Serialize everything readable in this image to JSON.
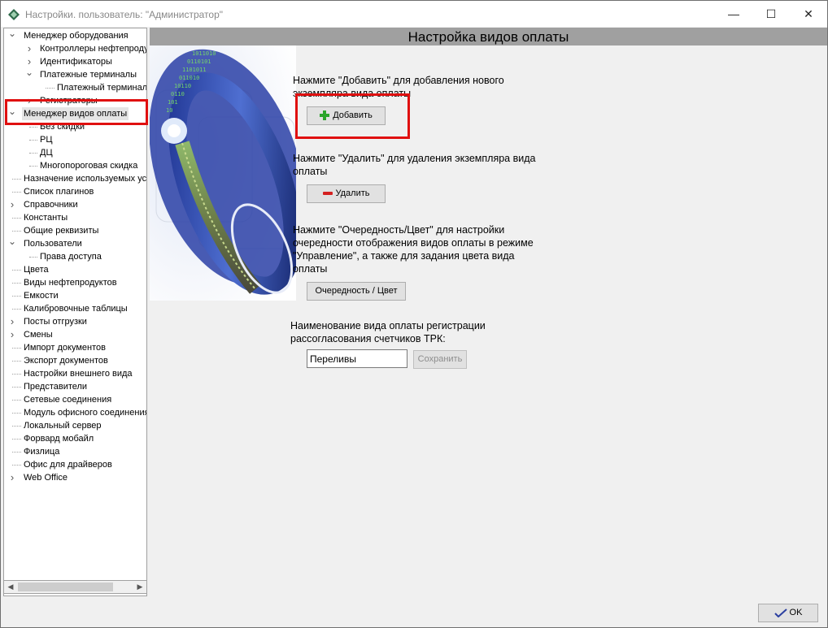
{
  "window": {
    "title": "Настройки. пользователь: \"Администратор\"",
    "minimize_glyph": "—",
    "maximize_glyph": "☐",
    "close_glyph": "✕"
  },
  "tree": {
    "items": [
      {
        "label": "Менеджер оборудования",
        "level": 0,
        "expander": "down"
      },
      {
        "label": "Контроллеры нефтепродуктов",
        "level": 1,
        "expander": "right"
      },
      {
        "label": "Идентификаторы",
        "level": 1,
        "expander": "right"
      },
      {
        "label": "Платежные терминалы",
        "level": 1,
        "expander": "down"
      },
      {
        "label": "Платежный терминал",
        "level": 2,
        "expander": "none"
      },
      {
        "label": "Регистраторы",
        "level": 1,
        "expander": "right"
      },
      {
        "label": "Менеджер видов оплаты",
        "level": 0,
        "expander": "down",
        "selected": true
      },
      {
        "label": "Без скидки",
        "level": 1,
        "expander": "none"
      },
      {
        "label": "РЦ",
        "level": 1,
        "expander": "none"
      },
      {
        "label": "ДЦ",
        "level": 1,
        "expander": "none"
      },
      {
        "label": "Многопороговая скидка",
        "level": 1,
        "expander": "none"
      },
      {
        "label": "Назначение используемых устройств",
        "level": 0,
        "expander": "none"
      },
      {
        "label": "Список плагинов",
        "level": 0,
        "expander": "none"
      },
      {
        "label": "Справочники",
        "level": 0,
        "expander": "right"
      },
      {
        "label": "Константы",
        "level": 0,
        "expander": "none"
      },
      {
        "label": "Общие реквизиты",
        "level": 0,
        "expander": "none"
      },
      {
        "label": "Пользователи",
        "level": 0,
        "expander": "down"
      },
      {
        "label": "Права доступа",
        "level": 1,
        "expander": "none"
      },
      {
        "label": "Цвета",
        "level": 0,
        "expander": "none"
      },
      {
        "label": "Виды нефтепродуктов",
        "level": 0,
        "expander": "none"
      },
      {
        "label": "Емкости",
        "level": 0,
        "expander": "none"
      },
      {
        "label": "Калибровочные таблицы",
        "level": 0,
        "expander": "none"
      },
      {
        "label": "Посты отгрузки",
        "level": 0,
        "expander": "right"
      },
      {
        "label": "Смены",
        "level": 0,
        "expander": "right"
      },
      {
        "label": "Импорт документов",
        "level": 0,
        "expander": "none"
      },
      {
        "label": "Экспорт документов",
        "level": 0,
        "expander": "none"
      },
      {
        "label": "Настройки внешнего вида",
        "level": 0,
        "expander": "none"
      },
      {
        "label": "Представители",
        "level": 0,
        "expander": "none"
      },
      {
        "label": "Сетевые соединения",
        "level": 0,
        "expander": "none"
      },
      {
        "label": "Модуль офисного соединения",
        "level": 0,
        "expander": "none"
      },
      {
        "label": "Локальный сервер",
        "level": 0,
        "expander": "none"
      },
      {
        "label": "Форвард мобайл",
        "level": 0,
        "expander": "none"
      },
      {
        "label": "Физлица",
        "level": 0,
        "expander": "none"
      },
      {
        "label": "Офис для драйверов",
        "level": 0,
        "expander": "none"
      },
      {
        "label": "Web Office",
        "level": 0,
        "expander": "right"
      }
    ]
  },
  "panel": {
    "header": "Настройка видов оплаты",
    "add_desc": "Нажмите \"Добавить\" для добавления нового экземпляра вида оплаты",
    "add_label": "Добавить",
    "delete_desc": "Нажмите \"Удалить\" для удаления экземпляра вида оплаты",
    "delete_label": "Удалить",
    "order_desc": "Нажмите \"Очередность/Цвет\" для настройки очередности отображения видов оплаты в режиме \"Управление\", а также для задания цвета вида оплаты",
    "order_label": "Очередность / Цвет",
    "name_desc": "Наименование вида оплаты регистрации рассогласования счетчиков ТРК:",
    "name_value": "Переливы",
    "save_label": "Сохранить"
  },
  "footer": {
    "ok_label": "OK"
  },
  "colors": {
    "highlight_box": "#e01010",
    "header_bg": "#a0a0a0",
    "add_icon": "#2aa52a",
    "delete_icon": "#d42020"
  }
}
